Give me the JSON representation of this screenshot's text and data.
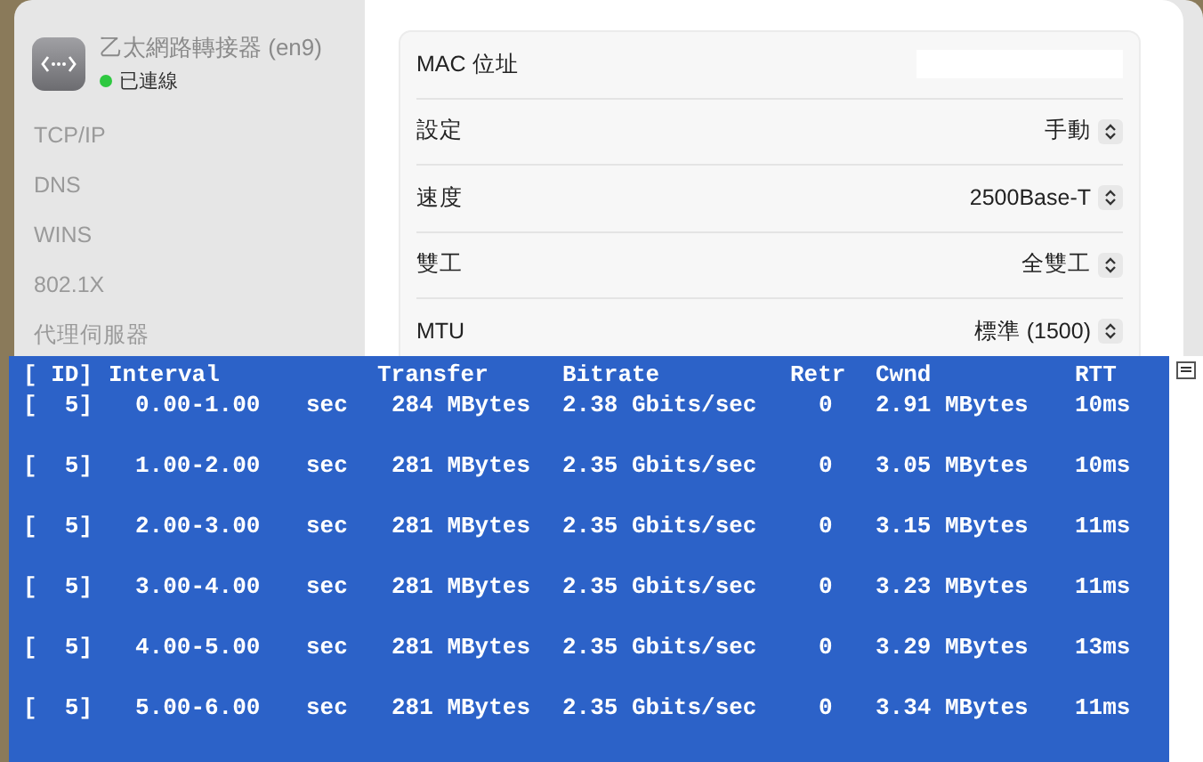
{
  "adapter": {
    "name": "乙太網路轉接器 (en9)",
    "status": "已連線"
  },
  "sidebar": {
    "items": [
      {
        "label": "TCP/IP",
        "selected": false
      },
      {
        "label": "DNS",
        "selected": false
      },
      {
        "label": "WINS",
        "selected": false
      },
      {
        "label": "802.1X",
        "selected": false
      },
      {
        "label": "代理伺服器",
        "selected": false
      }
    ]
  },
  "settings": [
    {
      "kind": "blank",
      "label": "MAC 位址"
    },
    {
      "kind": "popup",
      "label": "設定",
      "value": "手動"
    },
    {
      "kind": "popup",
      "label": "速度",
      "value": "2500Base-T"
    },
    {
      "kind": "popup",
      "label": "雙工",
      "value": "全雙工"
    },
    {
      "kind": "popup",
      "label": "MTU",
      "value": "標準 (1500)"
    }
  ],
  "terminal": {
    "header": [
      "[ ID]",
      "Interval",
      "Transfer",
      "Bitrate",
      "Retr",
      "Cwnd",
      "RTT"
    ],
    "rows": [
      [
        "[  5]",
        "0.00-1.00",
        "sec",
        "284 MBytes",
        "2.38 Gbits/sec",
        "0",
        "2.91 MBytes",
        "10ms"
      ],
      [
        "[  5]",
        "1.00-2.00",
        "sec",
        "281 MBytes",
        "2.35 Gbits/sec",
        "0",
        "3.05 MBytes",
        "10ms"
      ],
      [
        "[  5]",
        "2.00-3.00",
        "sec",
        "281 MBytes",
        "2.35 Gbits/sec",
        "0",
        "3.15 MBytes",
        "11ms"
      ],
      [
        "[  5]",
        "3.00-4.00",
        "sec",
        "281 MBytes",
        "2.35 Gbits/sec",
        "0",
        "3.23 MBytes",
        "11ms"
      ],
      [
        "[  5]",
        "4.00-5.00",
        "sec",
        "281 MBytes",
        "2.35 Gbits/sec",
        "0",
        "3.29 MBytes",
        "13ms"
      ],
      [
        "[  5]",
        "5.00-6.00",
        "sec",
        "281 MBytes",
        "2.35 Gbits/sec",
        "0",
        "3.34 MBytes",
        "11ms"
      ]
    ]
  }
}
